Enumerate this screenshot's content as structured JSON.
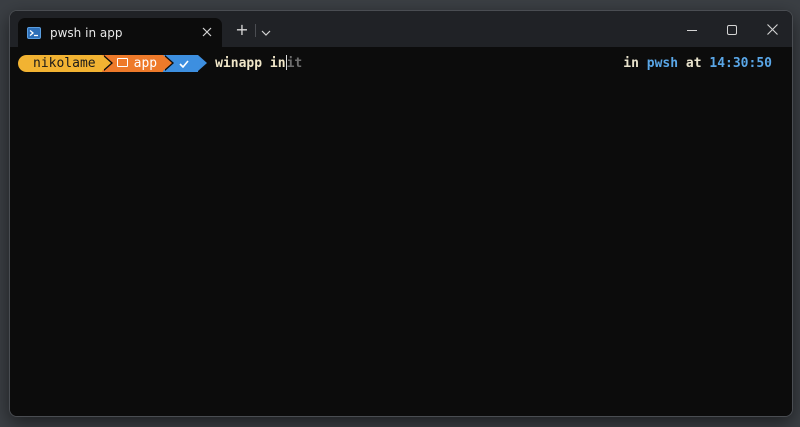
{
  "tab": {
    "icon": "powershell-icon",
    "title": "pwsh in app",
    "close_icon": "close-icon"
  },
  "tabbar": {
    "new_tab_icon": "plus-icon",
    "new_tab_glyph": "+",
    "dropdown_icon": "chevron-down-icon"
  },
  "window_controls": {
    "minimize_icon": "minimize-icon",
    "maximize_icon": "maximize-icon",
    "close_icon": "close-icon"
  },
  "prompt": {
    "user": "nikolame",
    "directory": "app",
    "directory_icon": "folder-icon",
    "status_icon": "checkmark-icon",
    "command_typed": "winapp in",
    "autosuggest": "it",
    "right": {
      "in_label": "in",
      "shell": "pwsh",
      "at_label": "at",
      "time": "14:30:50"
    }
  },
  "colors": {
    "user_segment": "#f2b332",
    "directory_segment": "#ee7a2a",
    "status_segment": "#3d8fe0",
    "terminal_background": "#0c0c0c",
    "titlebar": "#202226",
    "accent_blue": "#5aa7e8"
  }
}
